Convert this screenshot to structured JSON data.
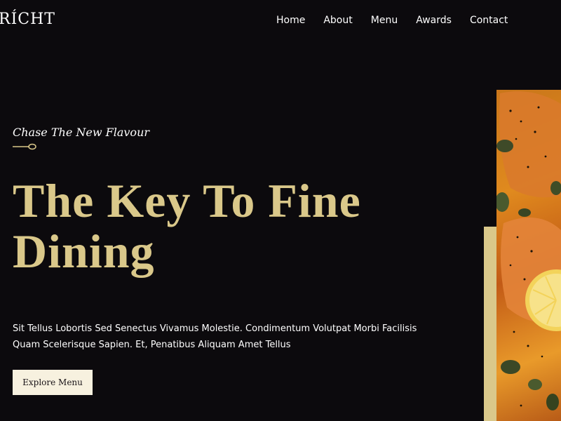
{
  "brand": {
    "logo_text": "RÍCHT"
  },
  "nav": {
    "items": [
      {
        "label": "Home"
      },
      {
        "label": "About"
      },
      {
        "label": "Menu"
      },
      {
        "label": "Awards"
      },
      {
        "label": "Contact"
      }
    ]
  },
  "hero": {
    "tagline": "Chase The New Flavour",
    "headline": "The Key To Fine Dining",
    "description": "Sit Tellus Lobortis Sed Senectus Vivamus Molestie. Condimentum Volutpat Morbi Facilisis Quam Scelerisque Sapien. Et, Penatibus Aliquam Amet Tellus",
    "cta_label": "Explore Menu",
    "image_subject": "salmon-fillet-with-lemon",
    "decor_icon": "spoon-icon"
  },
  "colors": {
    "background": "#0c0a0d",
    "accent_gold": "#dac88a",
    "button_bg": "#f7f1df",
    "text": "#ffffff"
  }
}
